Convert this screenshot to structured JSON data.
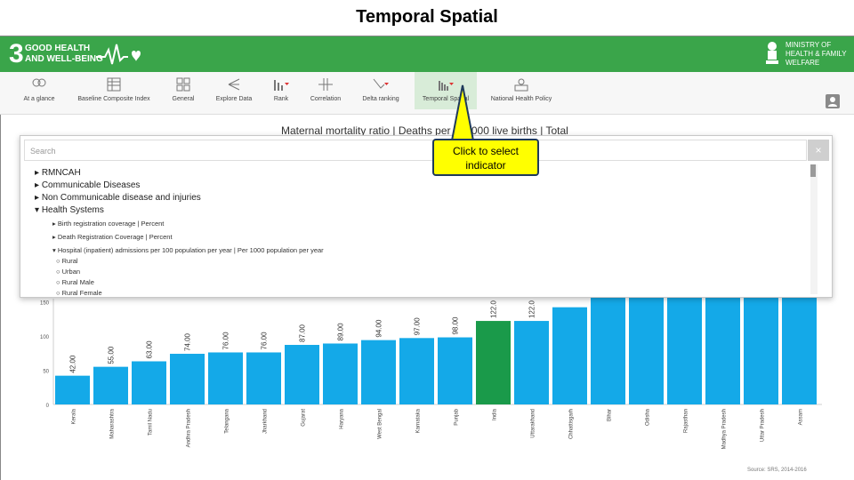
{
  "slide_title": "Temporal Spatial",
  "header": {
    "sdg_number": "3",
    "sdg_line1": "GOOD HEALTH",
    "sdg_line2": "AND WELL-BEING",
    "ministry_line1": "MINISTRY OF",
    "ministry_line2": "HEALTH & FAMILY",
    "ministry_line3": "WELFARE",
    "color_green": "#3aa54a"
  },
  "toolbar": {
    "items": [
      {
        "label": "At a glance",
        "icon": "people-icon"
      },
      {
        "label": "Baseline Composite Index",
        "icon": "table-icon"
      },
      {
        "label": "General",
        "icon": "grid-icon"
      },
      {
        "label": "Explore Data",
        "icon": "tree-icon"
      },
      {
        "label": "Rank",
        "icon": "rank-icon"
      },
      {
        "label": "Correlation",
        "icon": "correlation-icon"
      },
      {
        "label": "Delta ranking",
        "icon": "delta-icon"
      },
      {
        "label": "Temporal Spatial",
        "icon": "temporal-icon"
      },
      {
        "label": "National Health Policy",
        "icon": "policy-icon"
      }
    ],
    "active": "Temporal Spatial"
  },
  "chart_title_text": "Maternal mortality ratio | Deaths per 100000 live births | Total",
  "dropdown": {
    "search_placeholder": "Search",
    "close_label": "×",
    "items": [
      {
        "label": "RMNCAH",
        "level": 1
      },
      {
        "label": "Communicable Diseases",
        "level": 1
      },
      {
        "label": "Non Communicable disease and injuries",
        "level": 1
      },
      {
        "label": "Health Systems",
        "level": 1
      },
      {
        "label": "Birth registration coverage | Percent",
        "level": 2
      },
      {
        "label": "Death Registration Coverage | Percent",
        "level": 2
      },
      {
        "label": "Hospital (inpatient) admissions per 100 population per year | Per 1000 population per year",
        "level": 2
      },
      {
        "label": "Rural",
        "level": 3
      },
      {
        "label": "Urban",
        "level": 3
      },
      {
        "label": "Rural Male",
        "level": 3
      },
      {
        "label": "Rural Female",
        "level": 3
      }
    ]
  },
  "callout": {
    "line1": "Click to select",
    "line2": "indicator"
  },
  "source": "Source: SRS, 2014-2016",
  "chart_data": {
    "type": "bar",
    "ylim": [
      0,
      150
    ],
    "yticks": [
      0,
      50,
      100,
      150
    ],
    "categories": [
      "Kerala",
      "Maharashtra",
      "Tamil Nadu",
      "Andhra Pradesh",
      "Telangana",
      "Jharkhand",
      "Gujarat",
      "Haryana",
      "West Bengal",
      "Karnataka",
      "Punjab",
      "India",
      "Uttarakhand",
      "Chhattisgarh",
      "Bihar",
      "Odisha",
      "Rajasthan",
      "Madhya Pradesh",
      "Uttar Pradesh",
      "Assam"
    ],
    "values": [
      42.0,
      55.0,
      63.0,
      74.0,
      76.0,
      76.0,
      87.0,
      89.0,
      94.0,
      97.0,
      98.0,
      122.0,
      122.0,
      142.0,
      165.0,
      175.0,
      180.0,
      188.0,
      195.0,
      229.0
    ],
    "value_labels": [
      "42.00",
      "55.00",
      "63.00",
      "74.00",
      "76.00",
      "76.00",
      "87.00",
      "89.00",
      "94.00",
      "97.00",
      "98.00",
      "122.0",
      "122.0",
      "",
      "",
      "",
      "",
      "",
      "",
      ""
    ],
    "highlight": "India",
    "bar_color": "#14a9e8",
    "highlight_color": "#1a9a4a"
  }
}
